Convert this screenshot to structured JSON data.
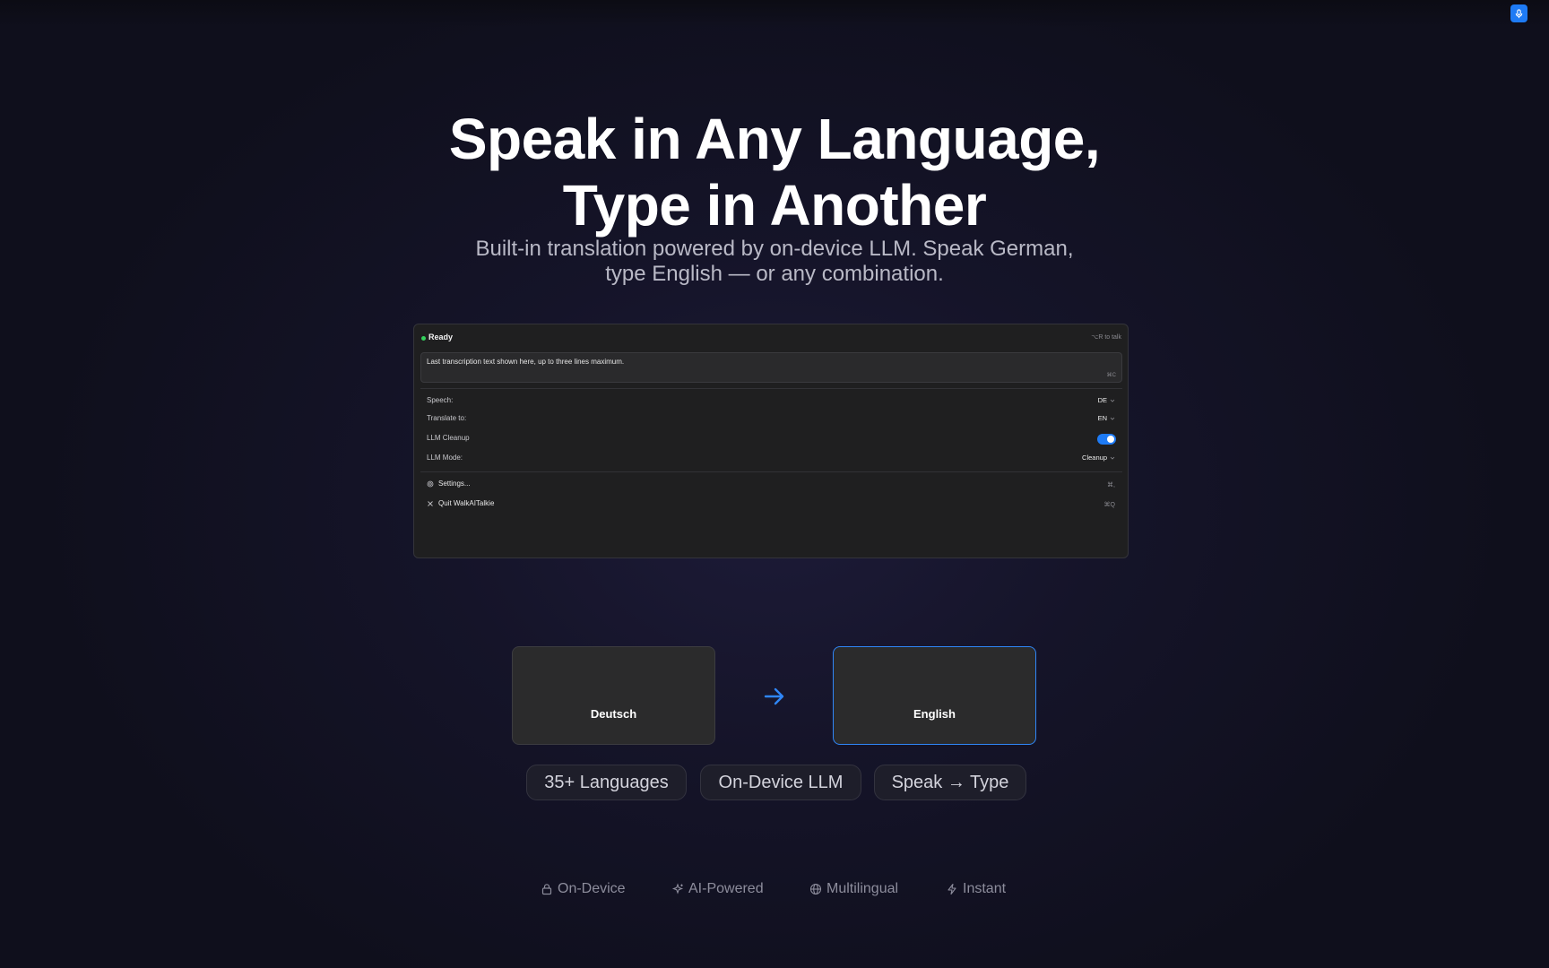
{
  "hero": {
    "title_line1": "Speak in Any Language,",
    "title_line2": "Type in Another",
    "subtitle_line1": "Built-in translation powered by on-device LLM. Speak German,",
    "subtitle_line2": "type English — or any combination."
  },
  "menu": {
    "status": "Ready",
    "hint": "⌥R to talk",
    "transcript": "Last transcription text shown here, up to three lines maximum.",
    "copy_shortcut": "⌘C",
    "rows": [
      {
        "label": "Speech:",
        "value": "DE"
      },
      {
        "label": "Translate to:",
        "value": "EN"
      },
      {
        "label": "LLM Cleanup",
        "toggle": true
      },
      {
        "label": "LLM Mode:",
        "value": "Cleanup"
      }
    ],
    "items": [
      {
        "label": "Settings...",
        "shortcut": "⌘,"
      },
      {
        "label": "Quit WalkAITalkie",
        "shortcut": "⌘Q"
      }
    ]
  },
  "languages": {
    "source": "Deutsch",
    "target": "English"
  },
  "pills": [
    "35+ Languages",
    "On-Device LLM",
    "Speak → Type"
  ],
  "features": [
    "On-Device",
    "AI-Powered",
    "Multilingual",
    "Instant"
  ],
  "colors": {
    "accent": "#1e7bf5",
    "status_green": "#33d05b",
    "background": "#0f0f1c"
  },
  "icons": [
    "mic-icon",
    "arrow-right-icon",
    "gear-icon",
    "close-icon",
    "lock-icon",
    "sparkles-icon",
    "globe-icon",
    "bolt-icon",
    "chevron-down-icon"
  ]
}
